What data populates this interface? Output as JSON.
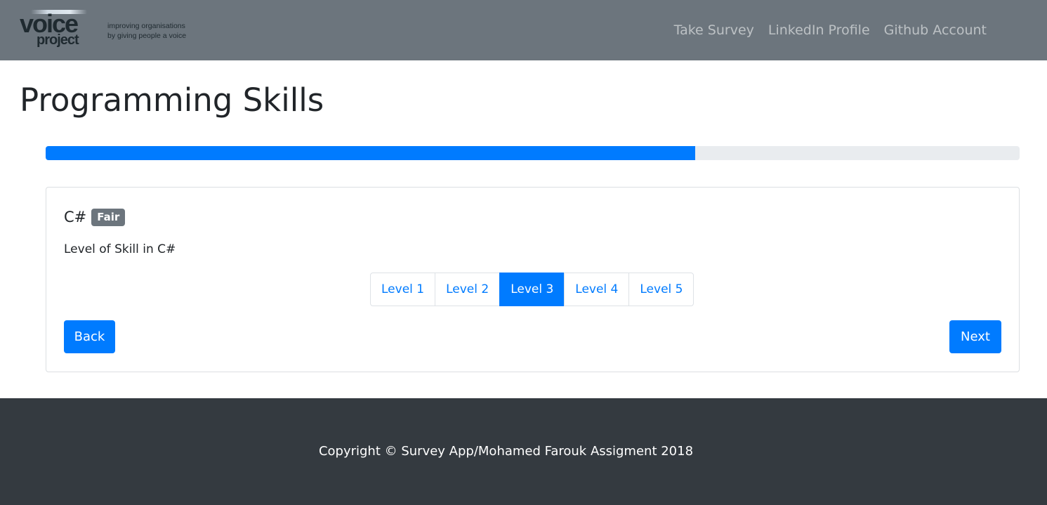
{
  "navbar": {
    "logo": {
      "word1": "voice",
      "word2": "project",
      "tagline_line1": "improving organisations",
      "tagline_line2": "by giving people a voice"
    },
    "links": [
      {
        "label": "Take Survey"
      },
      {
        "label": "LinkedIn Profile"
      },
      {
        "label": "Github Account"
      }
    ]
  },
  "page": {
    "title": "Programming Skills"
  },
  "progress": {
    "value_percent": 66.7,
    "color": "#007bff",
    "track_color": "#e9ecef"
  },
  "card": {
    "skill_name": "C#",
    "rating_badge": "Fair",
    "question": "Level of Skill in C#",
    "levels": [
      {
        "label": "Level 1",
        "selected": false
      },
      {
        "label": "Level 2",
        "selected": false
      },
      {
        "label": "Level 3",
        "selected": true
      },
      {
        "label": "Level 4",
        "selected": false
      },
      {
        "label": "Level 5",
        "selected": false
      }
    ],
    "back_label": "Back",
    "next_label": "Next"
  },
  "footer": {
    "text": "Copyright © Survey App/Mohamed Farouk Assigment 2018"
  },
  "colors": {
    "navbar_bg": "#6c757d",
    "primary": "#007bff",
    "footer_bg": "#343a40",
    "badge_bg": "#6c757d"
  }
}
